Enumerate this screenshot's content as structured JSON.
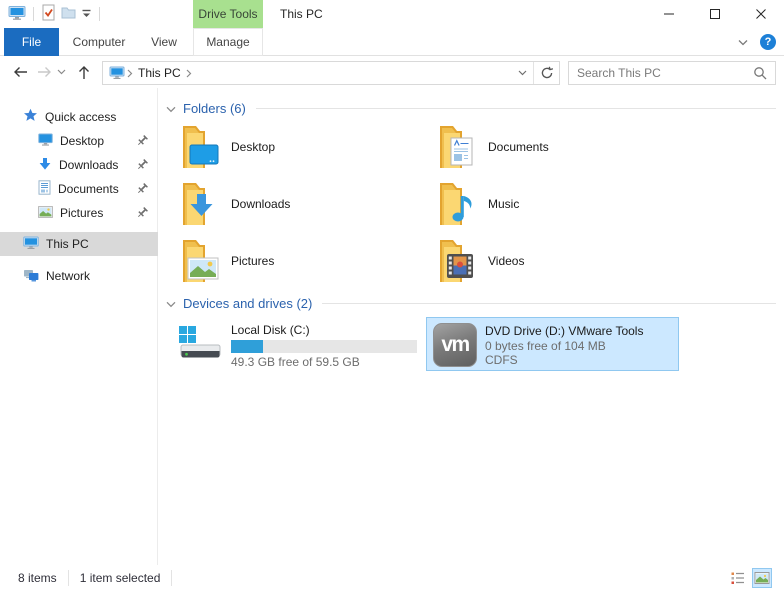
{
  "window": {
    "title": "This PC"
  },
  "titlebar": {
    "contextual_group_label": "Drive Tools"
  },
  "ribbon": {
    "tabs": [
      {
        "label": "File"
      },
      {
        "label": "Computer"
      },
      {
        "label": "View"
      },
      {
        "label": "Manage"
      }
    ],
    "active_tab": "File",
    "help_glyph": "?"
  },
  "navbar": {
    "breadcrumb_root": "This PC",
    "search_placeholder": "Search This PC"
  },
  "sidebar": {
    "items": [
      {
        "label": "Quick access",
        "pinned": false
      },
      {
        "label": "Desktop",
        "pinned": true
      },
      {
        "label": "Downloads",
        "pinned": true
      },
      {
        "label": "Documents",
        "pinned": true
      },
      {
        "label": "Pictures",
        "pinned": true
      },
      {
        "label": "This PC",
        "selected": true
      },
      {
        "label": "Network",
        "pinned": false
      }
    ]
  },
  "main": {
    "folders": {
      "title": "Folders (6)",
      "items": [
        {
          "label": "Desktop"
        },
        {
          "label": "Documents"
        },
        {
          "label": "Downloads"
        },
        {
          "label": "Music"
        },
        {
          "label": "Pictures"
        },
        {
          "label": "Videos"
        }
      ]
    },
    "drives": {
      "title": "Devices and drives (2)",
      "local_disk": {
        "name": "Local Disk (C:)",
        "free_text": "49.3 GB free of 59.5 GB",
        "used_percent": 17
      },
      "dvd": {
        "name": "DVD Drive (D:) VMware Tools",
        "free_text": "0 bytes free of 104 MB",
        "filesystem": "CDFS",
        "logo_text": "vm",
        "selected": true
      }
    }
  },
  "statusbar": {
    "items_count": "8 items",
    "selection_text": "1 item selected"
  },
  "colors": {
    "accent_blue": "#1b6cc0",
    "contextual_green": "#a8e08f",
    "selection_fill": "#cce8ff",
    "selection_border": "#90c8f0",
    "sidebar_selected": "#d9d9d9",
    "group_header_blue": "#2b62ad",
    "disk_bar_fill": "#2f9fd9",
    "disk_bar_track": "#e6e6e6"
  }
}
